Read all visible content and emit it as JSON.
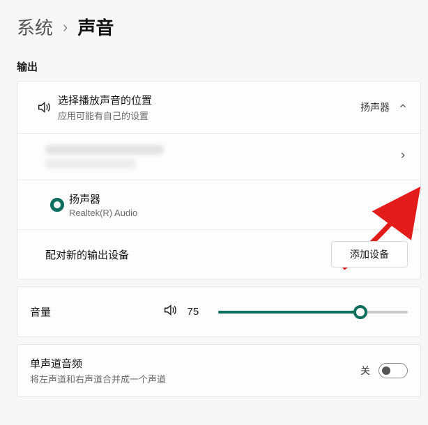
{
  "breadcrumb": {
    "system": "系统",
    "sound": "声音"
  },
  "output": {
    "heading": "输出",
    "choose": {
      "title": "选择播放声音的位置",
      "subtitle": "应用可能有自己的设置",
      "value": "扬声器"
    },
    "devices": {
      "blurred": {
        "name": "(已隐藏设备)"
      },
      "speaker": {
        "name": "扬声器",
        "desc": "Realtek(R) Audio",
        "selected": true
      }
    },
    "pair": {
      "label": "配对新的输出设备",
      "button": "添加设备"
    }
  },
  "volume": {
    "label": "音量",
    "value": 75,
    "pct": 75
  },
  "mono": {
    "title": "单声道音频",
    "subtitle": "将左声道和右声道合并成一个声道",
    "state_label": "关",
    "on": false
  },
  "accent": "#0f6f5e"
}
